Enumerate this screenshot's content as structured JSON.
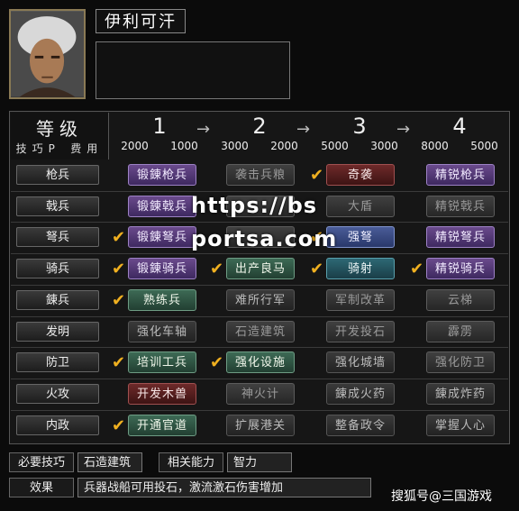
{
  "character": {
    "name": "伊利可汗"
  },
  "header": {
    "title": "等级",
    "sub_left": "技巧P",
    "sub_right": "费用"
  },
  "tiers": [
    {
      "level": "1",
      "tp": "2000",
      "cost": "1000"
    },
    {
      "level": "2",
      "tp": "3000",
      "cost": "2000"
    },
    {
      "level": "3",
      "tp": "5000",
      "cost": "3000"
    },
    {
      "level": "4",
      "tp": "8000",
      "cost": "5000"
    }
  ],
  "arrow": "→",
  "rows": [
    {
      "label": "枪兵",
      "skills": [
        {
          "name": "锻錬枪兵",
          "style": "purple",
          "learned": false
        },
        {
          "name": "袭击兵粮",
          "style": "gray",
          "learned": false
        },
        {
          "name": "奇袭",
          "style": "red",
          "learned": true
        },
        {
          "name": "精锐枪兵",
          "style": "purple",
          "learned": false
        }
      ]
    },
    {
      "label": "戟兵",
      "skills": [
        {
          "name": "锻錬戟兵",
          "style": "purple",
          "learned": false
        },
        {
          "name": "",
          "style": "gray",
          "learned": false
        },
        {
          "name": "大盾",
          "style": "gray",
          "learned": false
        },
        {
          "name": "精锐戟兵",
          "style": "gray",
          "learned": false
        }
      ]
    },
    {
      "label": "弩兵",
      "skills": [
        {
          "name": "锻錬弩兵",
          "style": "purple",
          "learned": true
        },
        {
          "name": "",
          "style": "gray",
          "learned": false
        },
        {
          "name": "强弩",
          "style": "blue",
          "learned": true
        },
        {
          "name": "精锐弩兵",
          "style": "purple",
          "learned": false
        }
      ]
    },
    {
      "label": "骑兵",
      "skills": [
        {
          "name": "锻錬骑兵",
          "style": "purple",
          "learned": true
        },
        {
          "name": "出产良马",
          "style": "green",
          "learned": true
        },
        {
          "name": "骑射",
          "style": "teal",
          "learned": true
        },
        {
          "name": "精锐骑兵",
          "style": "purple",
          "learned": true
        }
      ]
    },
    {
      "label": "錬兵",
      "skills": [
        {
          "name": "熟练兵",
          "style": "green",
          "learned": true
        },
        {
          "name": "难所行军",
          "style": "dgray",
          "learned": false
        },
        {
          "name": "军制改革",
          "style": "gray",
          "learned": false
        },
        {
          "name": "云梯",
          "style": "gray",
          "learned": false
        }
      ]
    },
    {
      "label": "发明",
      "skills": [
        {
          "name": "强化车轴",
          "style": "dgray",
          "learned": false
        },
        {
          "name": "石造建筑",
          "style": "gray",
          "learned": false
        },
        {
          "name": "开发投石",
          "style": "gray",
          "learned": false
        },
        {
          "name": "霹雳",
          "style": "gray",
          "learned": false
        }
      ]
    },
    {
      "label": "防卫",
      "skills": [
        {
          "name": "培训工兵",
          "style": "green",
          "learned": true
        },
        {
          "name": "强化设施",
          "style": "green",
          "learned": true
        },
        {
          "name": "强化城墙",
          "style": "dgray",
          "learned": false
        },
        {
          "name": "强化防卫",
          "style": "gray",
          "learned": false
        }
      ]
    },
    {
      "label": "火攻",
      "skills": [
        {
          "name": "开发木兽",
          "style": "red",
          "learned": false
        },
        {
          "name": "神火计",
          "style": "gray",
          "learned": false
        },
        {
          "name": "錬成火药",
          "style": "dgray",
          "learned": false
        },
        {
          "name": "錬成炸药",
          "style": "dgray",
          "learned": false
        }
      ]
    },
    {
      "label": "内政",
      "skills": [
        {
          "name": "开通官道",
          "style": "green",
          "learned": true
        },
        {
          "name": "扩展港关",
          "style": "dgray",
          "learned": false
        },
        {
          "name": "整备政令",
          "style": "dgray",
          "learned": false
        },
        {
          "name": "掌握人心",
          "style": "dgray",
          "learned": false
        }
      ]
    }
  ],
  "footer": {
    "req_label": "必要技巧",
    "req_value": "石造建筑",
    "ability_label": "相关能力",
    "ability_value": "智力",
    "effect_label": "效果",
    "effect_value": "兵器战船可用投石，激流激石伤害增加"
  },
  "overlay": {
    "line1": "https://bs",
    "line2": "portsa.com",
    "source": "搜狐号@三国游戏"
  },
  "colors": {
    "check": "#f0b020",
    "border": "#8a7a55"
  }
}
